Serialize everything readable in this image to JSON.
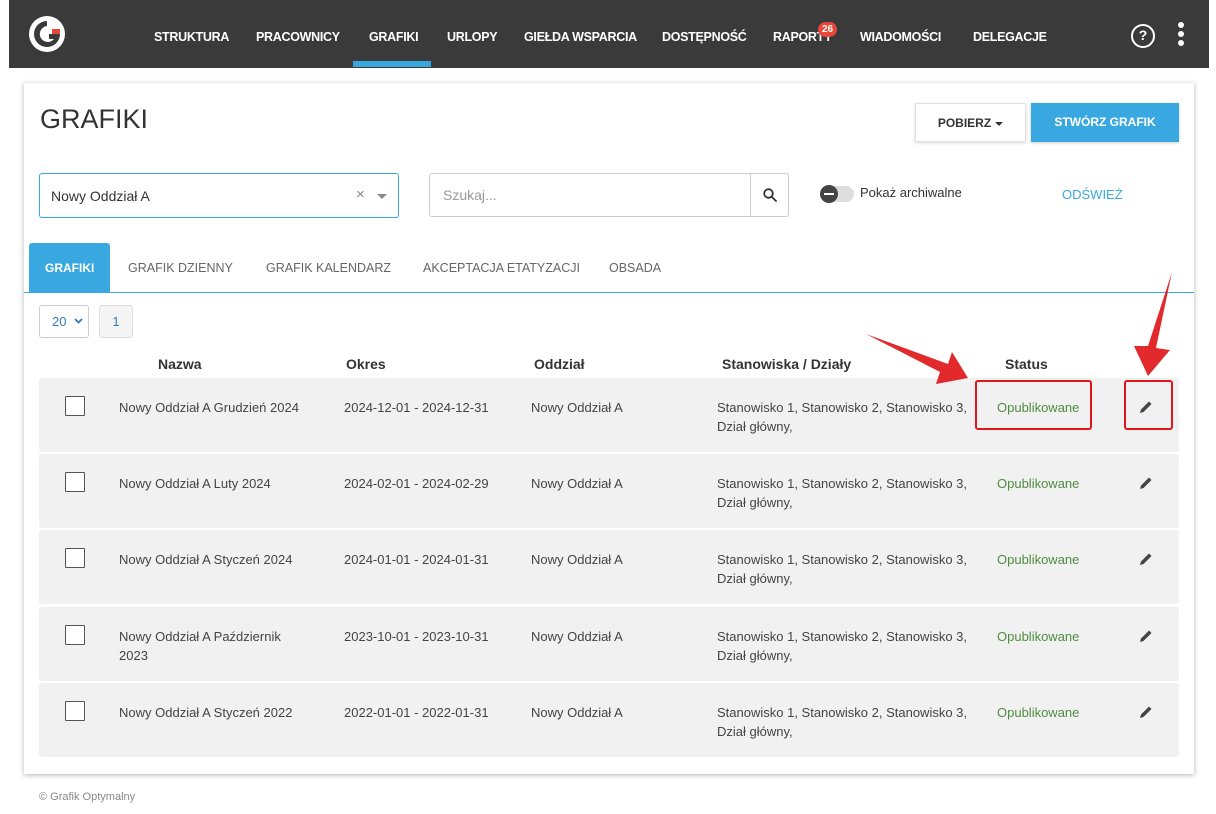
{
  "nav": {
    "items": [
      "STRUKTURA",
      "PRACOWNICY",
      "GRAFIKI",
      "URLOPY",
      "GIEŁDA WSPARCIA",
      "DOSTĘPNOŚĆ",
      "RAPORTY",
      "WIADOMOŚCI",
      "DELEGACJE"
    ],
    "active": "GRAFIKI",
    "reports_badge": "26",
    "help_glyph": "?",
    "icons": [
      "logo-icon",
      "help-icon",
      "kebab-menu-icon"
    ]
  },
  "page": {
    "title": "GRAFIKI",
    "download_label": "POBIERZ",
    "create_label": "STWÓRZ GRAFIK"
  },
  "filters": {
    "branch_value": "Nowy Oddział A",
    "clear_glyph": "×",
    "search_placeholder": "Szukaj...",
    "archive_toggle_label": "Pokaż archiwalne",
    "archive_toggle_on": false,
    "refresh_label": "ODŚWIEŻ"
  },
  "tabs": [
    "GRAFIKI",
    "GRAFIK DZIENNY",
    "GRAFIK KALENDARZ",
    "AKCEPTACJA ETATYZACJI",
    "OBSADA"
  ],
  "pagination": {
    "page_size": "20",
    "current_page": "1"
  },
  "table": {
    "headers": [
      "Nazwa",
      "Okres",
      "Oddział",
      "Stanowiska / Działy",
      "Status"
    ],
    "rows": [
      {
        "name": "Nowy Oddział A Grudzień 2024",
        "period": "2024-12-01 - 2024-12-31",
        "branch": "Nowy Oddział A",
        "positions": "Stanowisko 1, Stanowisko 2, Stanowisko 3, Dział główny,",
        "status": "Opublikowane"
      },
      {
        "name": "Nowy Oddział A Luty 2024",
        "period": "2024-02-01 - 2024-02-29",
        "branch": "Nowy Oddział A",
        "positions": "Stanowisko 1, Stanowisko 2, Stanowisko 3, Dział główny,",
        "status": "Opublikowane"
      },
      {
        "name": "Nowy Oddział A Styczeń 2024",
        "period": "2024-01-01 - 2024-01-31",
        "branch": "Nowy Oddział A",
        "positions": "Stanowisko 1, Stanowisko 2, Stanowisko 3, Dział główny,",
        "status": "Opublikowane"
      },
      {
        "name": "Nowy Oddział A Październik 2023",
        "period": "2023-10-01 - 2023-10-31",
        "branch": "Nowy Oddział A",
        "positions": "Stanowisko 1, Stanowisko 2, Stanowisko 3, Dział główny,",
        "status": "Opublikowane"
      },
      {
        "name": "Nowy Oddział A Styczeń 2022",
        "period": "2022-01-01 - 2022-01-31",
        "branch": "Nowy Oddział A",
        "positions": "Stanowisko 1, Stanowisko 2, Stanowisko 3, Dział główny,",
        "status": "Opublikowane"
      }
    ]
  },
  "footer": {
    "copyright": "© Grafik Optymalny"
  },
  "colors": {
    "accent": "#3aa8e0",
    "nav_bg": "#3a3a3a",
    "status_published": "#4f8c3f",
    "annotation_red": "#e0181b",
    "badge": "#e8473b"
  }
}
